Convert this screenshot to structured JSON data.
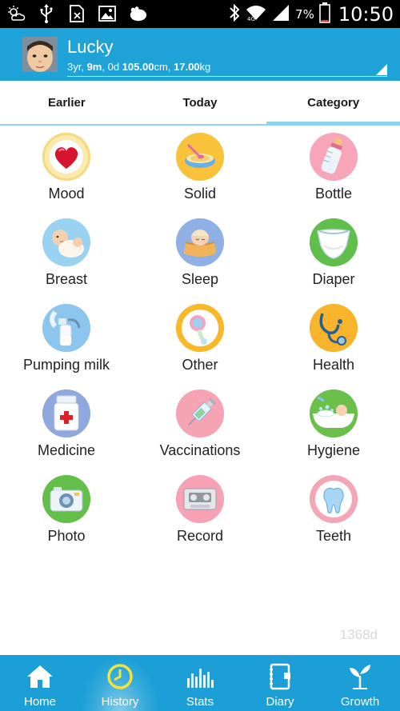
{
  "status_bar": {
    "battery_percent": "7%",
    "time": "10:50",
    "icons": [
      "weather-icon",
      "usb-icon",
      "no-sim-icon",
      "image-icon",
      "hippo-icon",
      "bluetooth-icon",
      "wifi-icon",
      "signal-icon",
      "battery-icon"
    ]
  },
  "profile": {
    "name": "Lucky",
    "age_years": "3yr, ",
    "age_months": "9m",
    "age_days": ", 0d ",
    "height": "105.00",
    "height_unit": "cm, ",
    "weight": "17.00",
    "weight_unit": "kg"
  },
  "tabs": [
    {
      "label": "Earlier",
      "active": false
    },
    {
      "label": "Today",
      "active": false
    },
    {
      "label": "Category",
      "active": true
    }
  ],
  "categories": [
    {
      "label": "Mood",
      "icon": "heart-icon"
    },
    {
      "label": "Solid",
      "icon": "bowl-icon"
    },
    {
      "label": "Bottle",
      "icon": "bottle-icon"
    },
    {
      "label": "Breast",
      "icon": "baby-icon"
    },
    {
      "label": "Sleep",
      "icon": "crib-icon"
    },
    {
      "label": "Diaper",
      "icon": "diaper-icon"
    },
    {
      "label": "Pumping milk",
      "icon": "breast-pump-icon"
    },
    {
      "label": "Other",
      "icon": "rattle-icon"
    },
    {
      "label": "Health",
      "icon": "stethoscope-icon"
    },
    {
      "label": "Medicine",
      "icon": "medicine-bottle-icon"
    },
    {
      "label": "Vaccinations",
      "icon": "syringe-icon"
    },
    {
      "label": "Hygiene",
      "icon": "bathtub-icon"
    },
    {
      "label": "Photo",
      "icon": "camera-icon"
    },
    {
      "label": "Record",
      "icon": "cassette-icon"
    },
    {
      "label": "Teeth",
      "icon": "tooth-icon"
    }
  ],
  "watermark": "1368d",
  "bottom_nav": [
    {
      "label": "Home",
      "icon": "home-icon",
      "active": false
    },
    {
      "label": "History",
      "icon": "clock-icon",
      "active": true
    },
    {
      "label": "Stats",
      "icon": "bar-chart-icon",
      "active": false
    },
    {
      "label": "Diary",
      "icon": "notebook-icon",
      "active": false
    },
    {
      "label": "Growth",
      "icon": "sprout-icon",
      "active": false
    }
  ],
  "colors": {
    "header_blue": "#1fa2d8",
    "nav_blue": "#1b9fd6",
    "tab_indicator": "#8fd3ef"
  }
}
